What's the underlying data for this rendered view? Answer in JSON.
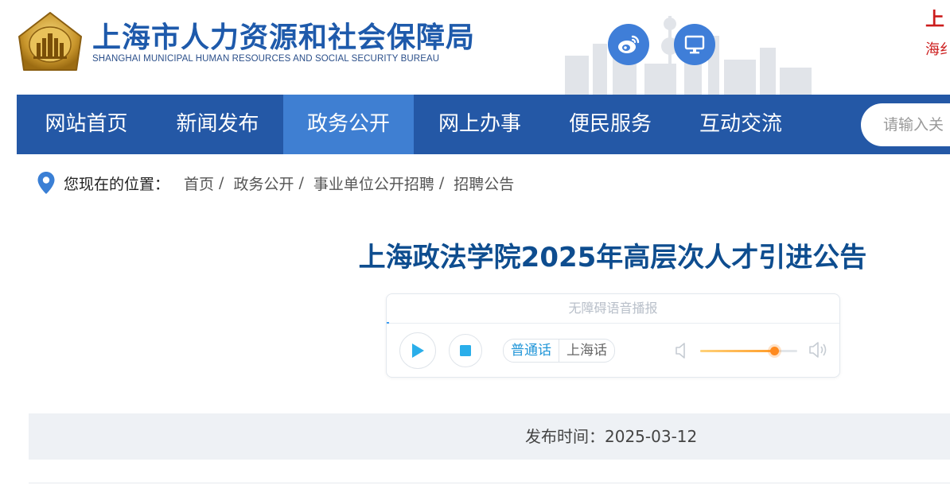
{
  "header": {
    "title_cn": "上海市人力资源和社会保障局",
    "title_en": "SHANGHAI MUNICIPAL HUMAN RESOURCES AND SOCIAL SECURITY BUREAU",
    "right_note_top": "上",
    "right_note_bottom": "海纟",
    "icons": [
      "weibo-icon",
      "desktop-icon"
    ]
  },
  "nav": {
    "items": [
      {
        "label": "网站首页"
      },
      {
        "label": "新闻发布"
      },
      {
        "label": "政务公开"
      },
      {
        "label": "网上办事"
      },
      {
        "label": "便民服务"
      },
      {
        "label": "互动交流"
      }
    ],
    "active_index": 2,
    "search_placeholder": "请输入关"
  },
  "breadcrumb": {
    "label": "您现在的位置：",
    "items": [
      "首页",
      "政务公开",
      "事业单位公开招聘",
      "招聘公告"
    ],
    "separator": "/"
  },
  "article": {
    "title": "上海政法学院2025年高层次人才引进公告",
    "publish_label": "发布时间：",
    "publish_date": "2025-03-12"
  },
  "player": {
    "header": "无障碍语音播报",
    "dialects": [
      "普通话",
      "上海话"
    ],
    "selected_dialect": "普通话",
    "volume_fraction": 0.76,
    "accent_color": "#2196d8",
    "volume_color": "#ff8a1e"
  },
  "colors": {
    "brand_blue": "#1e5aab",
    "nav_bg": "#2458a6",
    "nav_active": "#3f7fd2",
    "title_blue": "#0e4d8f"
  }
}
